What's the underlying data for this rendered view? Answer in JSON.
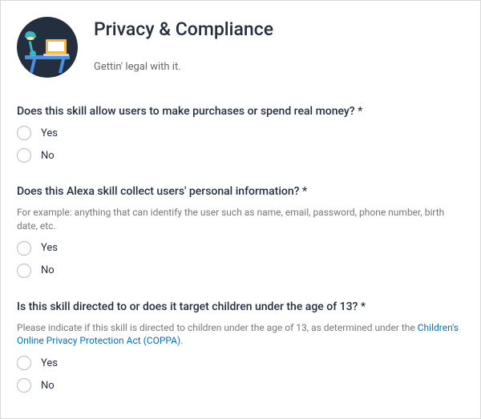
{
  "header": {
    "title": "Privacy & Compliance",
    "subtitle": "Gettin' legal with it."
  },
  "questions": [
    {
      "label": "Does this skill allow users to make purchases or spend real money? *",
      "helper": "",
      "link_text": "",
      "link_suffix": "",
      "options": {
        "yes": "Yes",
        "no": "No"
      }
    },
    {
      "label": "Does this Alexa skill collect users' personal information? *",
      "helper": "For example: anything that can identify the user such as name, email, password, phone number, birth date, etc.",
      "link_text": "",
      "link_suffix": "",
      "options": {
        "yes": "Yes",
        "no": "No"
      }
    },
    {
      "label": "Is this skill directed to or does it target children under the age of 13? *",
      "helper": "Please indicate if this skill is directed to children under the age of 13, as determined under the ",
      "link_text": "Children's Online Privacy Protection Act (COPPA)",
      "link_suffix": ".",
      "options": {
        "yes": "Yes",
        "no": "No"
      }
    }
  ]
}
